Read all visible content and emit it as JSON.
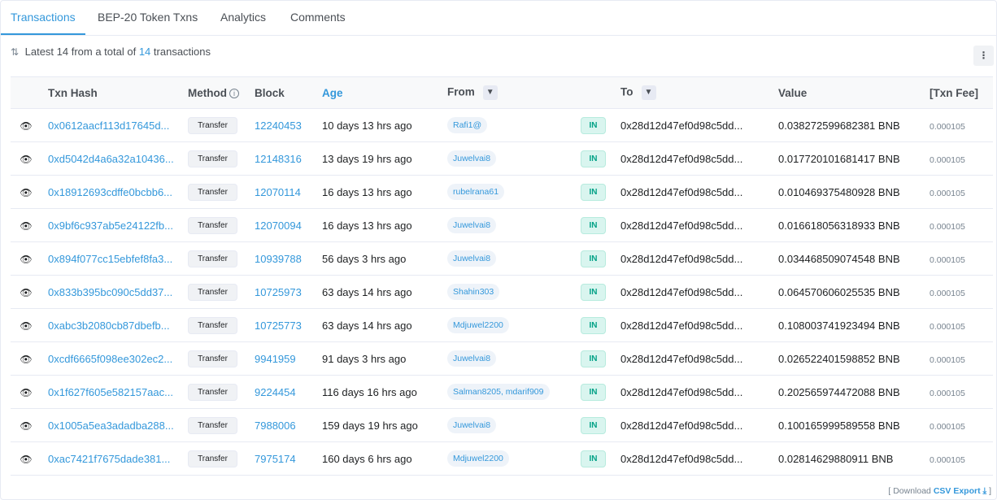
{
  "tabs": [
    "Transactions",
    "BEP-20 Token Txns",
    "Analytics",
    "Comments"
  ],
  "summary": {
    "prefix": "Latest 14 from a total of",
    "count": "14",
    "suffix": "transactions"
  },
  "more_icon": "more-vertical-icon",
  "columns": {
    "hash": "Txn Hash",
    "method": "Method",
    "block": "Block",
    "age": "Age",
    "from": "From",
    "to": "To",
    "value": "Value",
    "fee": "[Txn Fee]"
  },
  "rows": [
    {
      "hash": "0x0612aacf113d17645d...",
      "method": "Transfer",
      "block": "12240453",
      "age": "10 days 13 hrs ago",
      "from": "Rafi1@",
      "dir": "IN",
      "to": "0x28d12d47ef0d98c5dd...",
      "value": "0.038272599682381 BNB",
      "fee": "0.000105"
    },
    {
      "hash": "0xd5042d4a6a32a10436...",
      "method": "Transfer",
      "block": "12148316",
      "age": "13 days 19 hrs ago",
      "from": "Juwelvai8",
      "dir": "IN",
      "to": "0x28d12d47ef0d98c5dd...",
      "value": "0.017720101681417 BNB",
      "fee": "0.000105"
    },
    {
      "hash": "0x18912693cdffe0bcbb6...",
      "method": "Transfer",
      "block": "12070114",
      "age": "16 days 13 hrs ago",
      "from": "rubelrana61",
      "dir": "IN",
      "to": "0x28d12d47ef0d98c5dd...",
      "value": "0.010469375480928 BNB",
      "fee": "0.000105"
    },
    {
      "hash": "0x9bf6c937ab5e24122fb...",
      "method": "Transfer",
      "block": "12070094",
      "age": "16 days 13 hrs ago",
      "from": "Juwelvai8",
      "dir": "IN",
      "to": "0x28d12d47ef0d98c5dd...",
      "value": "0.016618056318933 BNB",
      "fee": "0.000105"
    },
    {
      "hash": "0x894f077cc15ebfef8fa3...",
      "method": "Transfer",
      "block": "10939788",
      "age": "56 days 3 hrs ago",
      "from": "Juwelvai8",
      "dir": "IN",
      "to": "0x28d12d47ef0d98c5dd...",
      "value": "0.034468509074548 BNB",
      "fee": "0.000105"
    },
    {
      "hash": "0x833b395bc090c5dd37...",
      "method": "Transfer",
      "block": "10725973",
      "age": "63 days 14 hrs ago",
      "from": "Shahin303",
      "dir": "IN",
      "to": "0x28d12d47ef0d98c5dd...",
      "value": "0.064570606025535 BNB",
      "fee": "0.000105"
    },
    {
      "hash": "0xabc3b2080cb87dbefb...",
      "method": "Transfer",
      "block": "10725773",
      "age": "63 days 14 hrs ago",
      "from": "Mdjuwel2200",
      "dir": "IN",
      "to": "0x28d12d47ef0d98c5dd...",
      "value": "0.108003741923494 BNB",
      "fee": "0.000105"
    },
    {
      "hash": "0xcdf6665f098ee302ec2...",
      "method": "Transfer",
      "block": "9941959",
      "age": "91 days 3 hrs ago",
      "from": "Juwelvai8",
      "dir": "IN",
      "to": "0x28d12d47ef0d98c5dd...",
      "value": "0.026522401598852 BNB",
      "fee": "0.000105"
    },
    {
      "hash": "0x1f627f605e582157aac...",
      "method": "Transfer",
      "block": "9224454",
      "age": "116 days 16 hrs ago",
      "from": "Salman8205, mdarif909",
      "dir": "IN",
      "to": "0x28d12d47ef0d98c5dd...",
      "value": "0.202565974472088 BNB",
      "fee": "0.000105"
    },
    {
      "hash": "0x1005a5ea3adadba288...",
      "method": "Transfer",
      "block": "7988006",
      "age": "159 days 19 hrs ago",
      "from": "Juwelvai8",
      "dir": "IN",
      "to": "0x28d12d47ef0d98c5dd...",
      "value": "0.100165999589558 BNB",
      "fee": "0.000105"
    },
    {
      "hash": "0xac7421f7675dade381...",
      "method": "Transfer",
      "block": "7975174",
      "age": "160 days 6 hrs ago",
      "from": "Mdjuwel2200",
      "dir": "IN",
      "to": "0x28d12d47ef0d98c5dd...",
      "value": "0.02814629880911 BNB",
      "fee": "0.000105"
    }
  ],
  "footer": {
    "open": "[ Download",
    "csv": "CSV Export",
    "close": "]"
  },
  "colors": {
    "accent": "#3498db",
    "in_badge": "#00a186"
  }
}
